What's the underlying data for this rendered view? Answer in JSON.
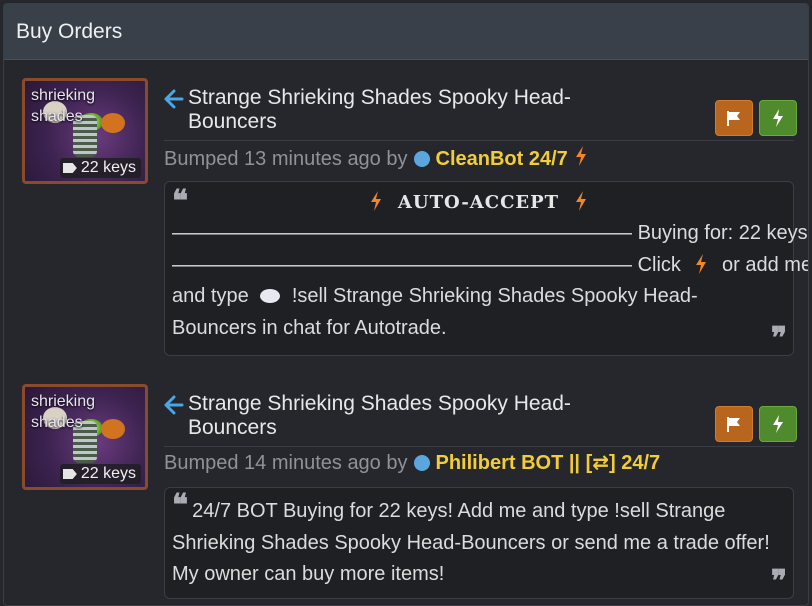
{
  "panel": {
    "title": "Buy Orders"
  },
  "orders": [
    {
      "thumb_name": "shrieking shades",
      "price": "22 keys",
      "title": "Strange Shrieking Shades Spooky Head-Bouncers",
      "bumped": "Bumped 13 minutes ago by",
      "user": "CleanBot 24/7",
      "auto_accept": "AUTO-ACCEPT",
      "line1_rule": "———————————————————————",
      "line1_text": "Buying for: 22 keys",
      "line2_rule": "———————————————————————",
      "line2_text": "Click",
      "line2_text_b": "or add me",
      "line3_text_a": "and type",
      "line3_text_b": "!sell Strange Shrieking Shades Spooky Head-",
      "line4_text": "Bouncers in chat for Autotrade."
    },
    {
      "thumb_name": "shrieking shades",
      "price": "22 keys",
      "title": "Strange Shrieking Shades Spooky Head-Bouncers",
      "bumped": "Bumped 14 minutes ago by",
      "user": "Philibert BOT || [⇄] 24/7",
      "message": "24/7 BOT Buying for 22 keys! Add me and type !sell Strange Shrieking Shades Spooky Head-Bouncers or send me a trade offer! My owner can buy more items!"
    }
  ],
  "icons": {
    "arrow": "back-arrow-icon",
    "flag": "flag-icon",
    "trade": "lightning-icon",
    "tag": "tag-icon",
    "status": "status-dot-icon",
    "bolt": "lightning-icon",
    "chat": "chat-bubble-icon",
    "quote_open": "quote-open-icon",
    "quote_close": "quote-close-icon"
  },
  "colors": {
    "user_name": "#f2cd3a",
    "flag_button": "#b8651e",
    "trade_button": "#4f8a2c",
    "status_dot": "#5aa7dd",
    "arrow": "#4aa6e6",
    "bolt": "#f2842a"
  },
  "glyphs": {
    "quote_open": "❝",
    "quote_close": "❞",
    "arrow": "🡐"
  }
}
